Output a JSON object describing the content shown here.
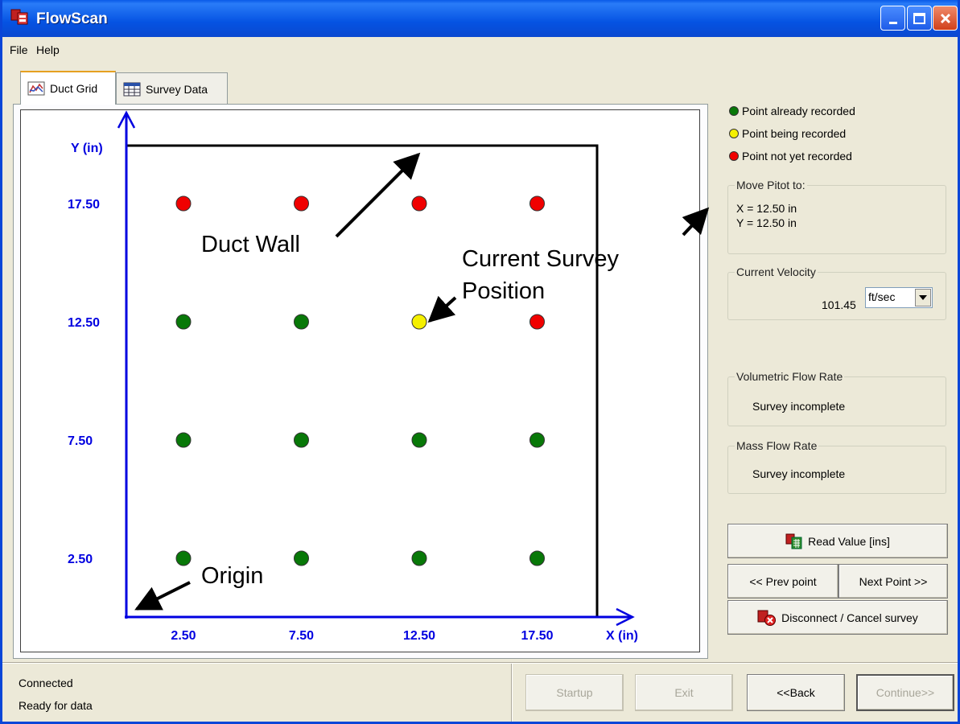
{
  "window": {
    "title": "FlowScan"
  },
  "menu": [
    "File",
    "Help"
  ],
  "tabs": [
    {
      "label": "Duct Grid",
      "icon": "chart-icon",
      "active": true
    },
    {
      "label": "Survey Data",
      "icon": "table-icon",
      "active": false
    }
  ],
  "grid": {
    "y_axis_label": "Y (in)",
    "x_axis_label": "X (in)",
    "y_ticks": [
      "17.50",
      "12.50",
      "7.50",
      "2.50"
    ],
    "x_ticks": [
      "2.50",
      "7.50",
      "12.50",
      "17.50"
    ],
    "points": [
      {
        "x": 2.5,
        "y": 17.5,
        "status": "not_recorded"
      },
      {
        "x": 7.5,
        "y": 17.5,
        "status": "not_recorded"
      },
      {
        "x": 12.5,
        "y": 17.5,
        "status": "not_recorded"
      },
      {
        "x": 17.5,
        "y": 17.5,
        "status": "not_recorded"
      },
      {
        "x": 2.5,
        "y": 12.5,
        "status": "recorded"
      },
      {
        "x": 7.5,
        "y": 12.5,
        "status": "recorded"
      },
      {
        "x": 12.5,
        "y": 12.5,
        "status": "recording"
      },
      {
        "x": 17.5,
        "y": 12.5,
        "status": "not_recorded"
      },
      {
        "x": 2.5,
        "y": 7.5,
        "status": "recorded"
      },
      {
        "x": 7.5,
        "y": 7.5,
        "status": "recorded"
      },
      {
        "x": 12.5,
        "y": 7.5,
        "status": "recorded"
      },
      {
        "x": 17.5,
        "y": 7.5,
        "status": "recorded"
      },
      {
        "x": 2.5,
        "y": 2.5,
        "status": "recorded"
      },
      {
        "x": 7.5,
        "y": 2.5,
        "status": "recorded"
      },
      {
        "x": 12.5,
        "y": 2.5,
        "status": "recorded"
      },
      {
        "x": 17.5,
        "y": 2.5,
        "status": "recorded"
      }
    ],
    "colors": {
      "recorded": "#087808",
      "recording": "#f5f000",
      "not_recorded": "#f00000",
      "axis": "#0000e0"
    }
  },
  "annotations": {
    "duct_wall": "Duct Wall",
    "current_position_line1": "Current Survey",
    "current_position_line2": "Position",
    "origin": "Origin"
  },
  "legend": {
    "recorded": "Point already recorded",
    "recording": "Point being recorded",
    "not_recorded": "Point not yet recorded"
  },
  "move_pitot": {
    "title": "Move Pitot to:",
    "x": "X = 12.50 in",
    "y": "Y = 12.50 in"
  },
  "velocity": {
    "title": "Current Velocity",
    "value": "101.45",
    "unit": "ft/sec"
  },
  "volumetric": {
    "title": "Volumetric Flow Rate",
    "value": "Survey incomplete"
  },
  "mass": {
    "title": "Mass Flow Rate",
    "value": "Survey incomplete"
  },
  "buttons": {
    "read_value": "Read Value [ins]",
    "prev_point": "<< Prev point",
    "next_point": "Next Point >>",
    "disconnect": "Disconnect / Cancel survey"
  },
  "status": {
    "line1": "Connected",
    "line2": "Ready for data"
  },
  "footer_buttons": {
    "startup": "Startup",
    "exit": "Exit",
    "back": "<<Back",
    "continue": "Continue>>"
  }
}
